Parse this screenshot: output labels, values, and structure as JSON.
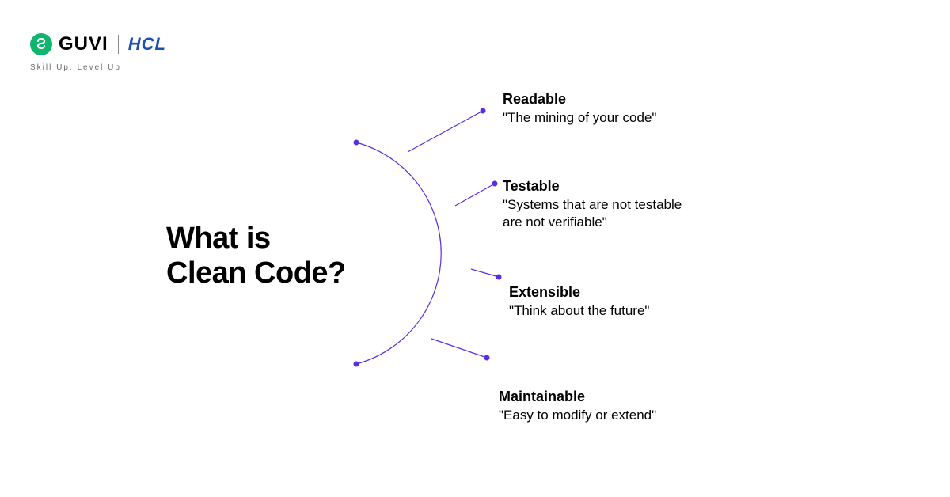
{
  "header": {
    "brand_primary": "GUVI",
    "brand_secondary": "HCL",
    "tagline": "Skill Up. Level Up"
  },
  "title": {
    "line1": "What is",
    "line2": "Clean Code?"
  },
  "concepts": [
    {
      "title": "Readable",
      "desc": "\"The mining of your code\""
    },
    {
      "title": "Testable",
      "desc": "\"Systems that are not testable\n are not verifiable\""
    },
    {
      "title": "Extensible",
      "desc": "\"Think about the future\""
    },
    {
      "title": "Maintainable",
      "desc": "\"Easy to modify or extend\""
    }
  ],
  "colors": {
    "accent": "#5b2de0",
    "brand_green": "#0fb56d",
    "brand_blue": "#1a4fb3"
  }
}
